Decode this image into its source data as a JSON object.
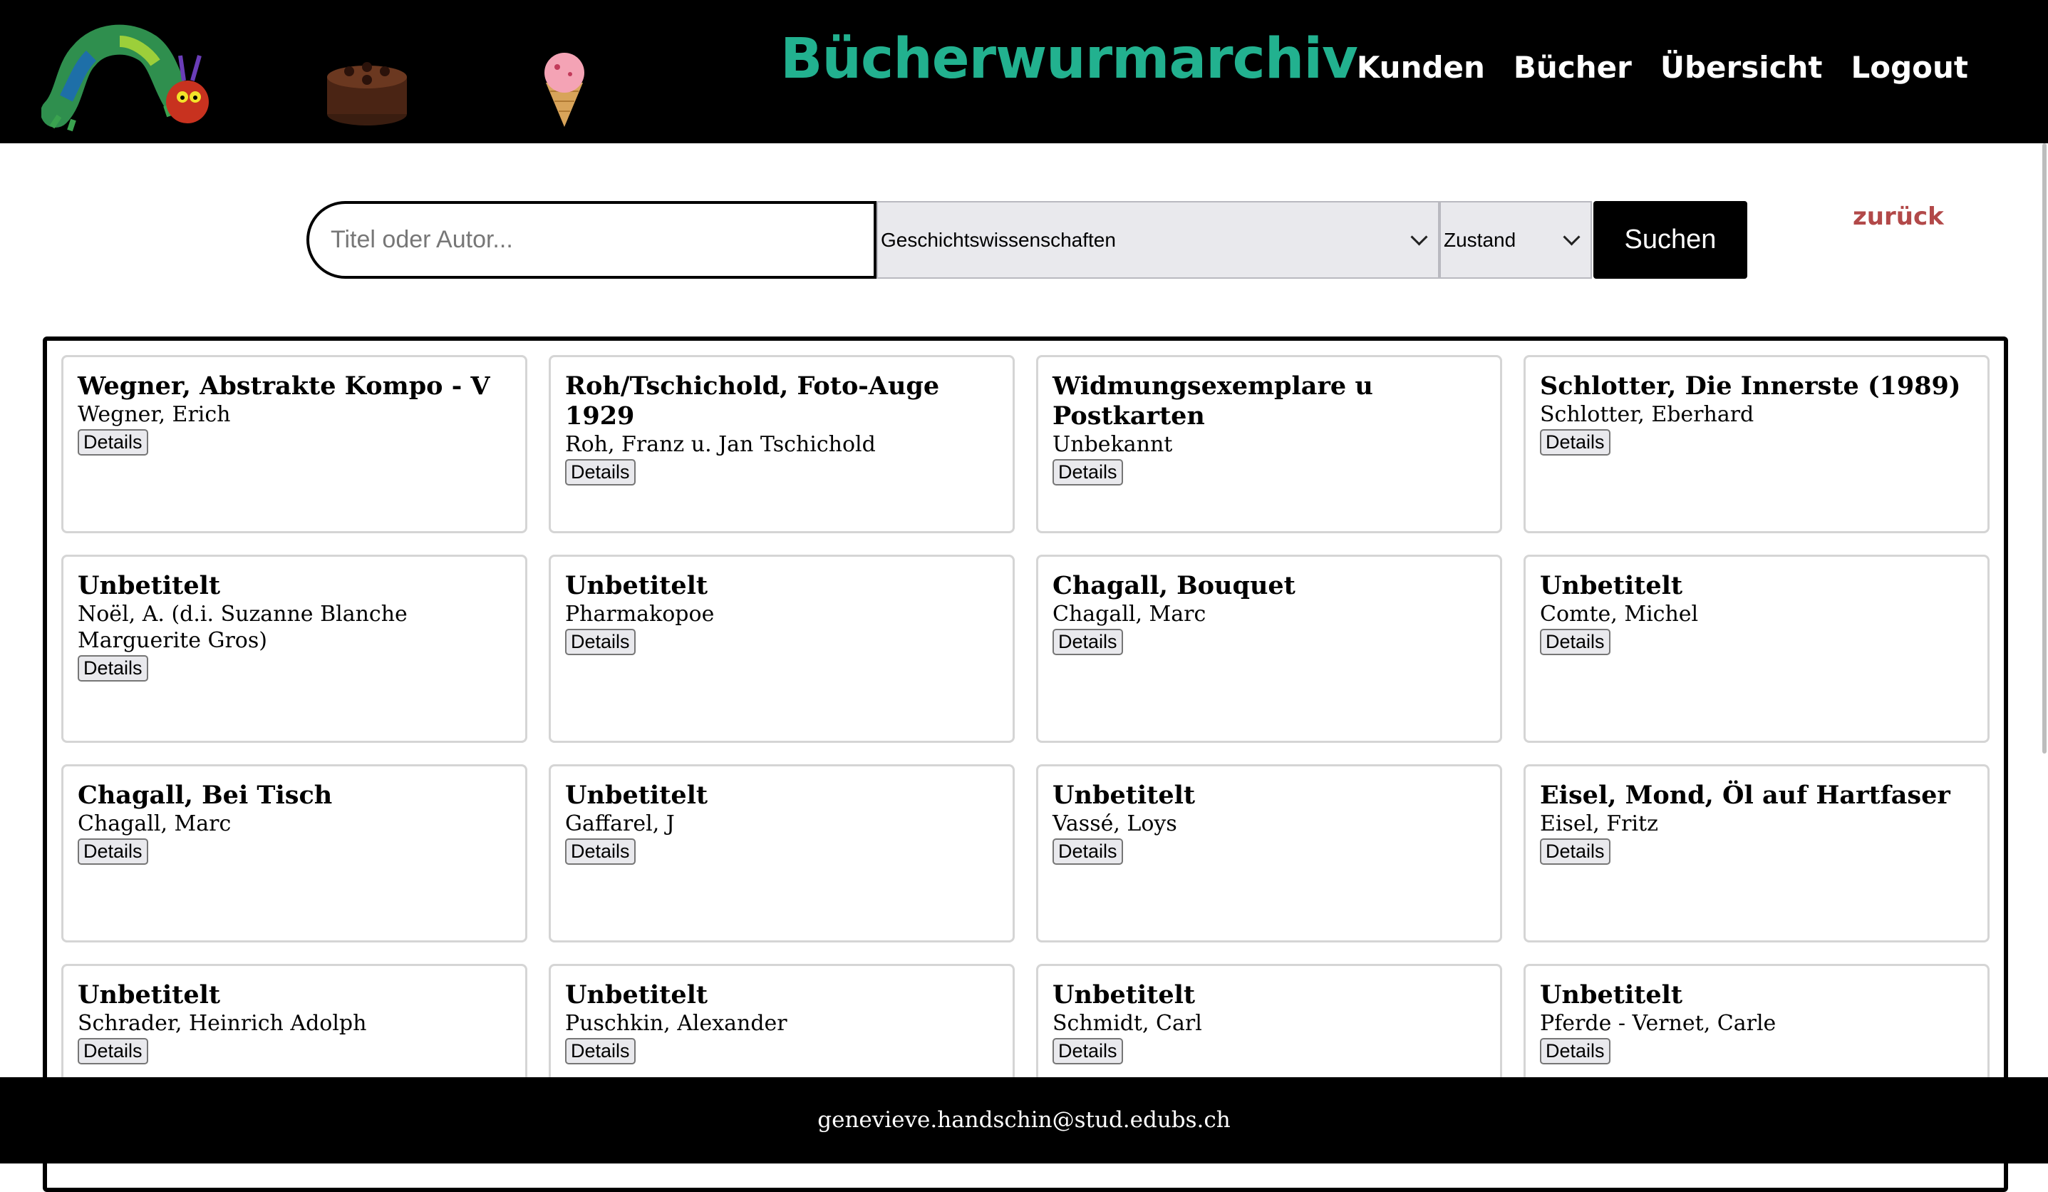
{
  "header": {
    "title": "Bücherwurmarchiv",
    "nav": [
      "Kunden",
      "Bücher",
      "Übersicht",
      "Logout"
    ],
    "icons": [
      "caterpillar-logo",
      "cake-image",
      "ice-cream-image"
    ]
  },
  "search": {
    "placeholder": "Titel oder Autor...",
    "value": "",
    "category_selected": "Geschichtswissenschaften",
    "condition_selected": "Zustand",
    "button_label": "Suchen"
  },
  "back_link": "zurück",
  "details_label": "Details",
  "books": [
    {
      "title": "Wegner, Abstrakte Kompo - V",
      "author": "Wegner, Erich"
    },
    {
      "title": "Roh/Tschichold, Foto-Auge 1929",
      "author": "Roh, Franz u. Jan Tschichold"
    },
    {
      "title": "Widmungsexemplare u Postkarten",
      "author": "Unbekannt"
    },
    {
      "title": "Schlotter, Die Innerste (1989)",
      "author": "Schlotter, Eberhard"
    },
    {
      "title": "Unbetitelt",
      "author": "Noël, A. (d.i. Suzanne Blanche Marguerite Gros)"
    },
    {
      "title": "Unbetitelt",
      "author": "Pharmakopoe"
    },
    {
      "title": "Chagall, Bouquet",
      "author": "Chagall, Marc"
    },
    {
      "title": "Unbetitelt",
      "author": "Comte, Michel"
    },
    {
      "title": "Chagall, Bei Tisch",
      "author": "Chagall, Marc"
    },
    {
      "title": "Unbetitelt",
      "author": "Gaffarel, J"
    },
    {
      "title": "Unbetitelt",
      "author": "Vassé, Loys"
    },
    {
      "title": "Eisel, Mond, Öl auf Hartfaser",
      "author": "Eisel, Fritz"
    },
    {
      "title": "Unbetitelt",
      "author": "Schrader, Heinrich Adolph"
    },
    {
      "title": "Unbetitelt",
      "author": "Puschkin, Alexander"
    },
    {
      "title": "Unbetitelt",
      "author": "Schmidt, Carl"
    },
    {
      "title": "Unbetitelt",
      "author": "Pferde - Vernet, Carle"
    }
  ],
  "footer": {
    "email": "genevieve.handschin@stud.edubs.ch"
  },
  "colors": {
    "title": "#22b18f",
    "back_link": "#b24949",
    "header_bg": "#000000"
  }
}
